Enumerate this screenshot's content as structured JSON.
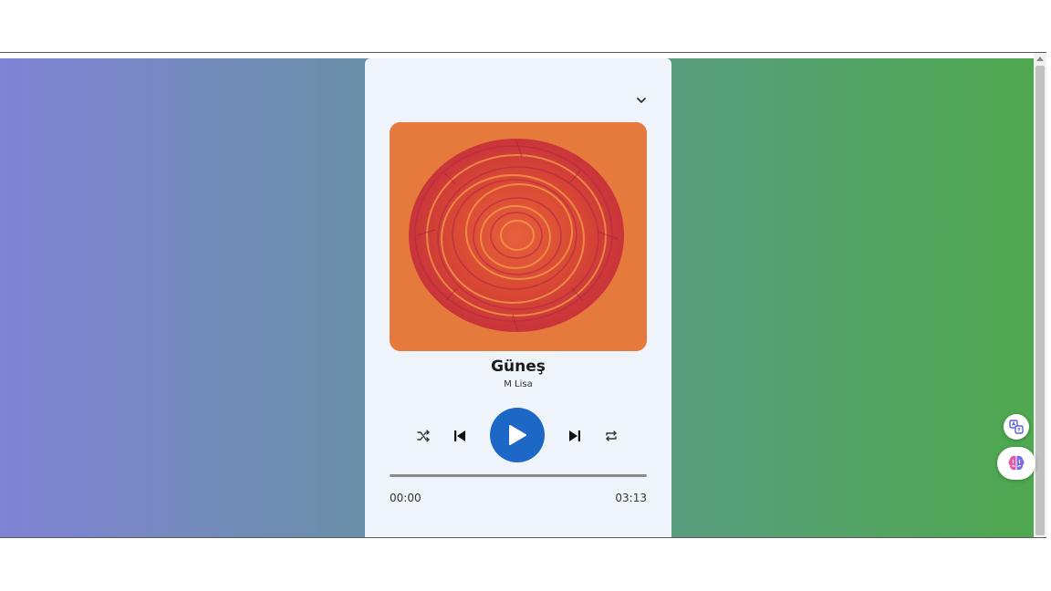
{
  "player": {
    "song_title": "Güneş",
    "artist": "M Lisa",
    "time_current": "00:00",
    "time_total": "03:13",
    "progress": 0
  },
  "icons": {
    "collapse": "chevron-down-icon",
    "shuffle": "shuffle-icon",
    "previous": "skip-previous-icon",
    "play": "play-icon",
    "next": "skip-next-icon",
    "repeat": "repeat-icon",
    "translate": "translate-icon",
    "assistant": "brain-icon"
  },
  "colors": {
    "accent": "#1d67c7",
    "card_bg": "#eef4f9",
    "gradient_start": "#7f84d6",
    "gradient_end": "#4ea84e",
    "album_bg": "#e57a3c"
  }
}
